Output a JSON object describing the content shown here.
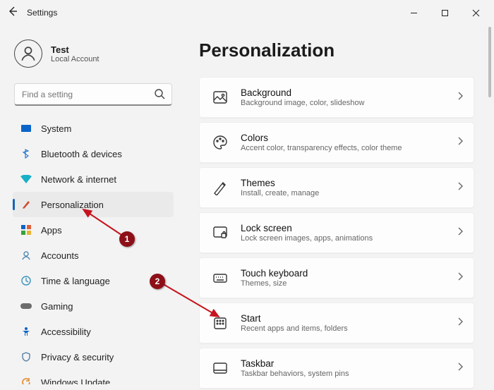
{
  "window": {
    "title": "Settings"
  },
  "account": {
    "name": "Test",
    "sub": "Local Account"
  },
  "search": {
    "placeholder": "Find a setting"
  },
  "nav": [
    {
      "label": "System"
    },
    {
      "label": "Bluetooth & devices"
    },
    {
      "label": "Network & internet"
    },
    {
      "label": "Personalization"
    },
    {
      "label": "Apps"
    },
    {
      "label": "Accounts"
    },
    {
      "label": "Time & language"
    },
    {
      "label": "Gaming"
    },
    {
      "label": "Accessibility"
    },
    {
      "label": "Privacy & security"
    },
    {
      "label": "Windows Update"
    }
  ],
  "page": {
    "title": "Personalization"
  },
  "cards": [
    {
      "title": "Background",
      "sub": "Background image, color, slideshow"
    },
    {
      "title": "Colors",
      "sub": "Accent color, transparency effects, color theme"
    },
    {
      "title": "Themes",
      "sub": "Install, create, manage"
    },
    {
      "title": "Lock screen",
      "sub": "Lock screen images, apps, animations"
    },
    {
      "title": "Touch keyboard",
      "sub": "Themes, size"
    },
    {
      "title": "Start",
      "sub": "Recent apps and items, folders"
    },
    {
      "title": "Taskbar",
      "sub": "Taskbar behaviors, system pins"
    }
  ],
  "annotations": {
    "b1": "1",
    "b2": "2"
  }
}
